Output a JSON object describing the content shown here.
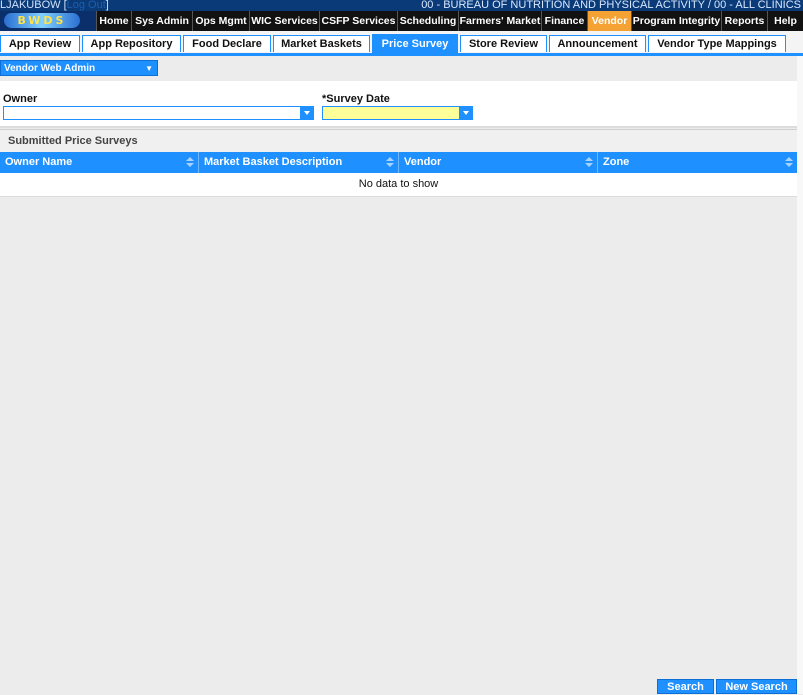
{
  "header": {
    "user": "LJAKUBOW [",
    "logout": "Log Out",
    "user_close": "]",
    "agency": "00 - BUREAU OF NUTRITION AND PHYSICAL ACTIVITY / 00 - ALL CLINICS",
    "logo_text": "BWDS"
  },
  "main_menu": [
    {
      "label": "Home"
    },
    {
      "label": "Sys Admin"
    },
    {
      "label": "Ops Mgmt"
    },
    {
      "label": "WIC Services"
    },
    {
      "label": "CSFP Services"
    },
    {
      "label": "Scheduling"
    },
    {
      "label": "Farmers' Market"
    },
    {
      "label": "Finance"
    },
    {
      "label": "Vendor",
      "active": true
    },
    {
      "label": "Program Integrity"
    },
    {
      "label": "Reports"
    },
    {
      "label": "Help"
    }
  ],
  "tabs": [
    {
      "label": "App Review"
    },
    {
      "label": "App Repository"
    },
    {
      "label": "Food Declare"
    },
    {
      "label": "Market Baskets"
    },
    {
      "label": "Price Survey",
      "active": true
    },
    {
      "label": "Store Review"
    },
    {
      "label": "Announcement"
    },
    {
      "label": "Vendor Type Mappings"
    }
  ],
  "sub_menu": {
    "label": "Vendor Web Admin"
  },
  "filters": {
    "owner_label": "Owner",
    "owner_value": "",
    "survey_date_label": "*Survey Date",
    "survey_date_value": ""
  },
  "grid": {
    "title": "Submitted Price Surveys",
    "columns": [
      "Owner Name",
      "Market Basket Description",
      "Vendor",
      "Zone"
    ],
    "empty_text": "No data to show"
  },
  "buttons": {
    "search": "Search",
    "new_search": "New Search"
  },
  "colors": {
    "accent": "#1e90ff",
    "active_menu": "#f5a234",
    "required_field": "#ffff99"
  }
}
